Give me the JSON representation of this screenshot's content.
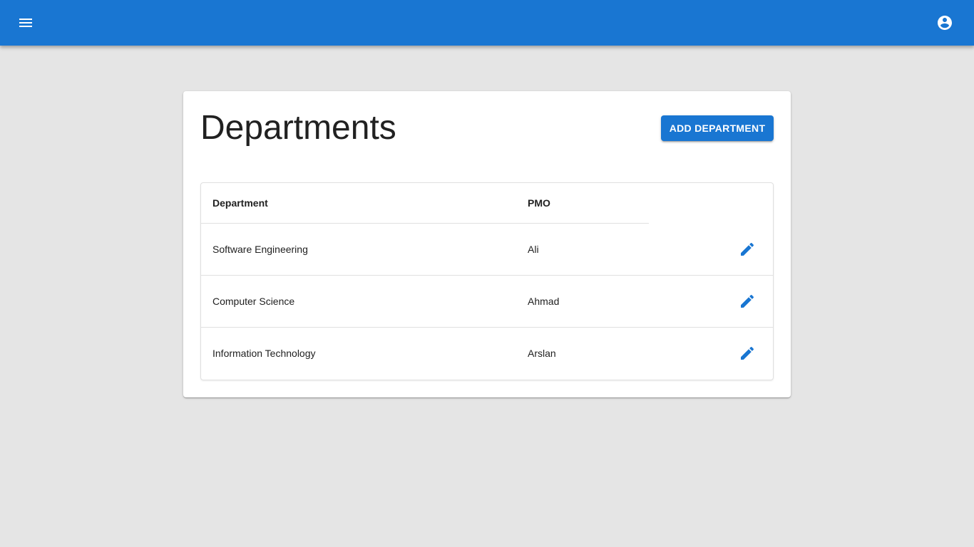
{
  "appbar": {
    "menu_icon": "menu-icon",
    "account_icon": "account-circle-icon",
    "color": "#1976d2"
  },
  "page": {
    "title": "Departments",
    "add_button_label": "ADD DEPARTMENT"
  },
  "table": {
    "columns": [
      "Department",
      "PMO"
    ],
    "rows": [
      {
        "department": "Software Engineering",
        "pmo": "Ali",
        "action_icon": "edit-icon"
      },
      {
        "department": "Computer Science",
        "pmo": "Ahmad",
        "action_icon": "edit-icon"
      },
      {
        "department": "Information Technology",
        "pmo": "Arslan",
        "action_icon": "edit-icon"
      }
    ]
  }
}
